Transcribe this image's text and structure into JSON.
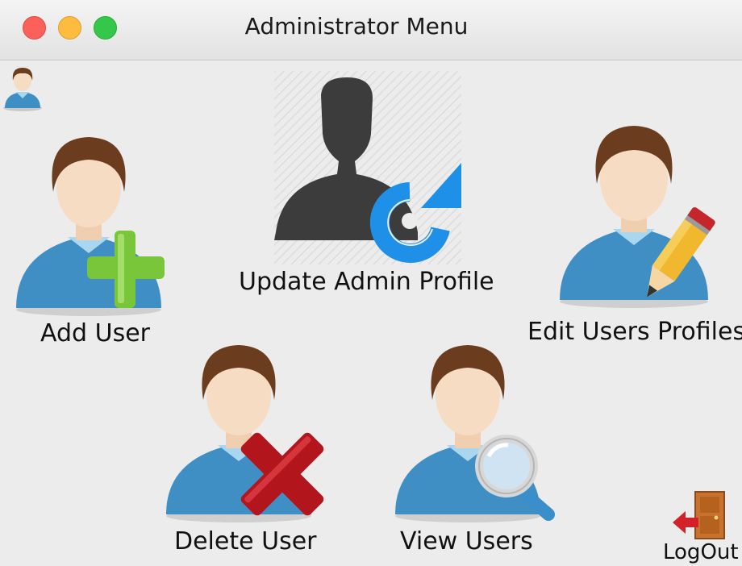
{
  "window": {
    "title": "Administrator Menu"
  },
  "menu": {
    "update_profile": "Update Admin Profile",
    "add_user": "Add User",
    "edit_profiles": "Edit Users Profiles",
    "delete_user": "Delete User",
    "view_users": "View Users",
    "logout": "LogOut"
  },
  "icons": {
    "current_user": "user-avatar-icon",
    "update_profile": "admin-refresh-icon",
    "add_user": "user-add-icon",
    "edit_profiles": "user-edit-icon",
    "delete_user": "user-delete-icon",
    "view_users": "user-search-icon",
    "logout": "door-exit-icon"
  },
  "colors": {
    "hair": "#6b3d1e",
    "skin": "#f7dcc4",
    "shirt": "#3f8fc4",
    "plus": "#7ac63a",
    "refresh": "#1e90e8",
    "cross": "#b3151c",
    "pencil": "#f0b72f",
    "door": "#c9722f"
  }
}
